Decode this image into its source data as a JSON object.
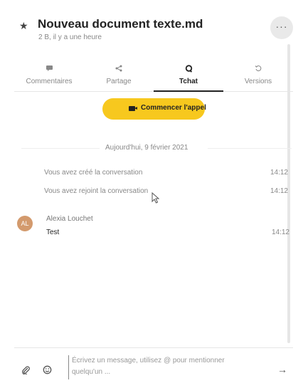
{
  "header": {
    "title": "Nouveau document texte.md",
    "subtitle": "2 B, il y a une heure",
    "more_label": "···"
  },
  "tabs": [
    {
      "label": "Commentaires",
      "icon": "comment-icon",
      "active": false
    },
    {
      "label": "Partage",
      "icon": "share-icon",
      "active": false
    },
    {
      "label": "Tchat",
      "icon": "chat-icon",
      "active": true
    },
    {
      "label": "Versions",
      "icon": "history-icon",
      "active": false
    }
  ],
  "call": {
    "label": "Commencer l'appel",
    "icon": "video-icon",
    "color": "#f7c81e"
  },
  "conversation": {
    "date_separator": "Aujourd'hui, 9 février 2021",
    "system_messages": [
      {
        "text": "Vous avez créé la conversation",
        "time": "14:12"
      },
      {
        "text": "Vous avez rejoint la conversation",
        "time": "14:12"
      }
    ],
    "messages": [
      {
        "initials": "AL",
        "author": "Alexia Louchet",
        "text": "Test",
        "time": "14:12",
        "avatar_color": "#d39a6d"
      }
    ]
  },
  "composer": {
    "placeholder_line1": "Écrivez un message, utilisez @ pour mentionner",
    "placeholder_line2": "quelqu'un ..."
  }
}
